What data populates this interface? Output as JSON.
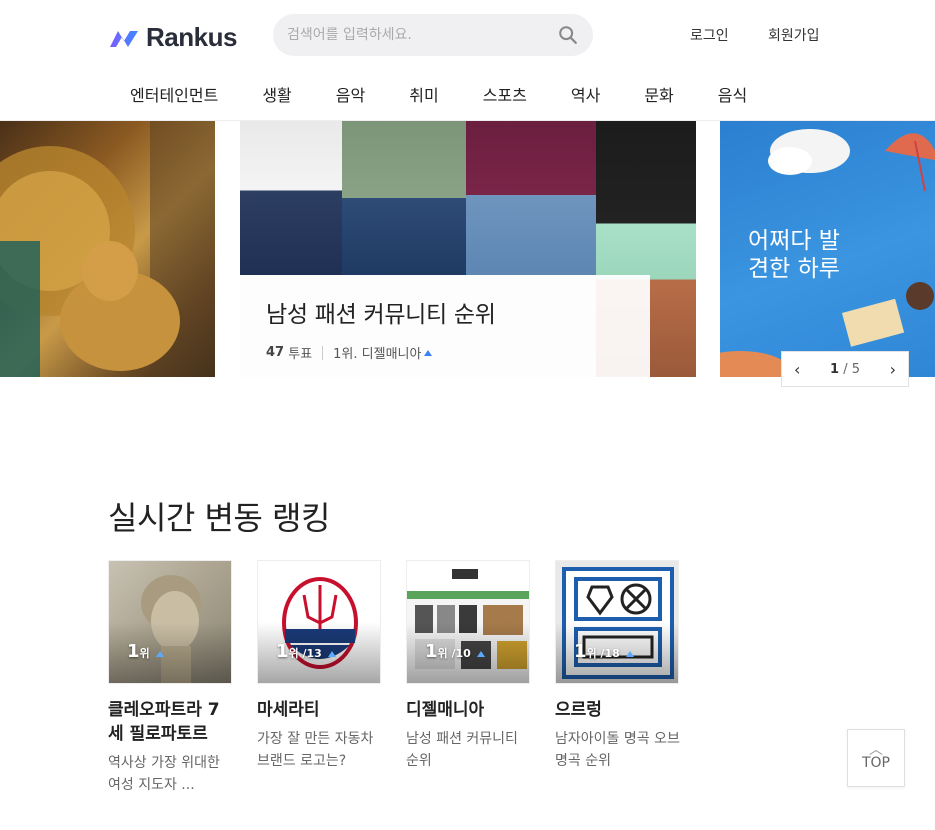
{
  "header": {
    "logo_text": "Rankus",
    "search_placeholder": "검색어를 입력하세요.",
    "login_label": "로그인",
    "signup_label": "회원가입"
  },
  "nav": {
    "categories": [
      "엔터테인먼트",
      "생활",
      "음악",
      "취미",
      "스포츠",
      "역사",
      "문화",
      "음식"
    ]
  },
  "carousel": {
    "center": {
      "title": "남성 패션 커뮤니티 순위",
      "votes_num": "47",
      "votes_label": "투표",
      "top_rank": "1위. 디젤매니아"
    },
    "right_overlay_text": "어쩌다 발견한 하루",
    "pager": {
      "current": "1",
      "total": "/ 5"
    }
  },
  "section": {
    "title": "실시간 변동 랭킹",
    "cards": [
      {
        "rank": "1",
        "rank_unit": "위",
        "extra": "",
        "title": "클레오파트라 7세 필로파토르",
        "desc": "역사상 가장 위대한 여성 지도자 ..."
      },
      {
        "rank": "1",
        "rank_unit": "위",
        "extra": "/13",
        "title": "마세라티",
        "desc": "가장 잘 만든 자동차 브랜드 로고는?"
      },
      {
        "rank": "1",
        "rank_unit": "위",
        "extra": "/10",
        "title": "디젤매니아",
        "desc": "남성 패션 커뮤니티 순위"
      },
      {
        "rank": "1",
        "rank_unit": "위",
        "extra": "/18",
        "title": "으르렁",
        "desc": "남자아이돌 명곡 오브 명곡 순위"
      }
    ]
  },
  "top_button_label": "TOP",
  "colors": {
    "accent": "#3b82f6",
    "logo_gradient_start": "#6a5cff",
    "logo_gradient_end": "#3d7bff"
  }
}
